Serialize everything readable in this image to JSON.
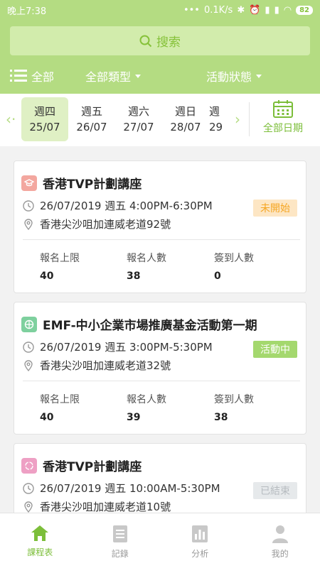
{
  "statusbar": {
    "time": "晚上7:38",
    "dots": "•••",
    "speed": "0.1K/s",
    "battery": "82"
  },
  "search": {
    "placeholder": "搜索"
  },
  "filters": {
    "all": "全部",
    "type": "全部類型",
    "status": "活動狀態"
  },
  "dates": [
    {
      "weekday": "週四",
      "date": "25/07"
    },
    {
      "weekday": "週五",
      "date": "26/07"
    },
    {
      "weekday": "週六",
      "date": "27/07"
    },
    {
      "weekday": "週日",
      "date": "28/07"
    },
    {
      "weekday": "週",
      "date": "29"
    }
  ],
  "all_dates_label": "全部日期",
  "events": [
    {
      "title": "香港TVP計劃講座",
      "datetime": "26/07/2019 週五 4:00PM-6:30PM",
      "location": "香港尖沙咀加連威老道92號",
      "status": "未開始",
      "stats": {
        "limit_label": "報名上限",
        "limit": "40",
        "registered_label": "報名人數",
        "registered": "38",
        "checkin_label": "簽到人數",
        "checkin": "0"
      }
    },
    {
      "title": "EMF-中小企業市場推廣基金活動第一期",
      "datetime": "26/07/2019 週五 3:00PM-5:30PM",
      "location": "香港尖沙咀加連威老道32號",
      "status": "活動中",
      "stats": {
        "limit_label": "報名上限",
        "limit": "40",
        "registered_label": "報名人數",
        "registered": "39",
        "checkin_label": "簽到人數",
        "checkin": "38"
      }
    },
    {
      "title": "香港TVP計劃講座",
      "datetime": "26/07/2019 週五 10:00AM-5:30PM",
      "location": "香港尖沙咀加連威老道10號",
      "status": "已結束"
    }
  ],
  "tabs": [
    {
      "label": "課程表",
      "icon": "home-icon"
    },
    {
      "label": "記錄",
      "icon": "document-icon"
    },
    {
      "label": "分析",
      "icon": "bar-chart-icon"
    },
    {
      "label": "我的",
      "icon": "person-icon"
    }
  ],
  "colors": {
    "brand": "#b4dc82",
    "accent": "#7cbe3a",
    "status_pending": "#f5a623",
    "status_active": "#7cbe3a",
    "status_ended": "#c5c9cc"
  }
}
